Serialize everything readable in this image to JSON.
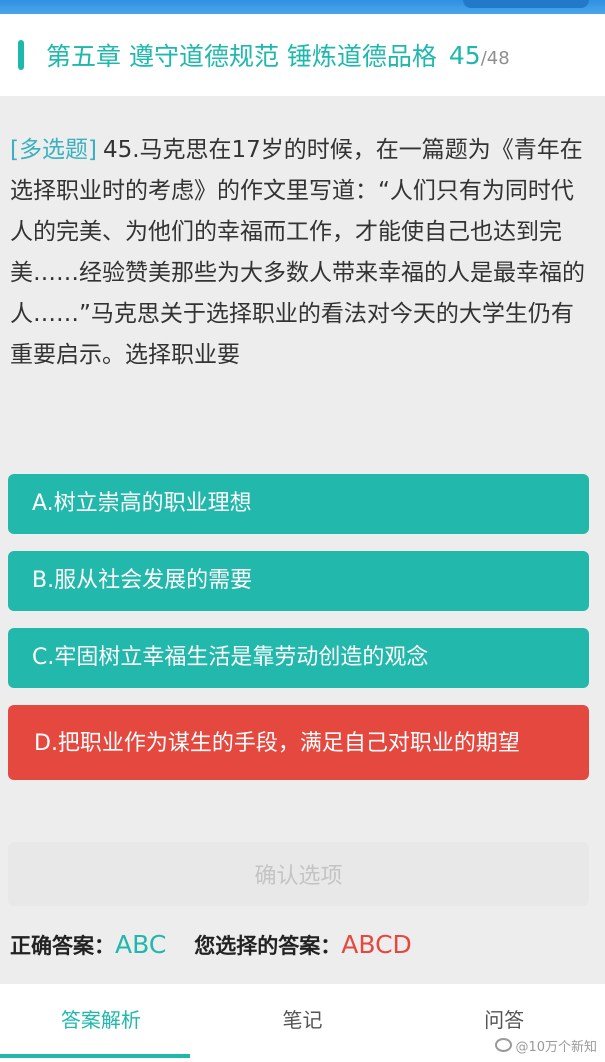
{
  "header": {
    "chapter_title": "第五章 遵守道德规范 锤炼道德品格",
    "current": "45",
    "separator": "/",
    "total": "48"
  },
  "question": {
    "type": "[多选题]",
    "text": "45.马克思在17岁的时候，在一篇题为《青年在选择职业时的考虑》的作文里写道：“人们只有为同时代人的完美、为他们的幸福而工作，才能使自己也达到完美……经验赞美那些为大多数人带来幸福的人是最幸福的人……”马克思关于选择职业的看法对今天的大学生仍有重要启示。选择职业要"
  },
  "options": [
    {
      "label": "A.树立崇高的职业理想",
      "status": "correct"
    },
    {
      "label": "B.服从社会发展的需要",
      "status": "correct"
    },
    {
      "label": "C.牢固树立幸福生活是靠劳动创造的观念",
      "status": "correct"
    },
    {
      "label": "D.把职业作为谋生的手段，满足自己对职业的期望",
      "status": "wrong"
    }
  ],
  "confirm_label": "确认选项",
  "answers": {
    "correct_label": "正确答案：",
    "correct_value": "ABC",
    "user_label": "您选择的答案：",
    "user_value": "ABCD"
  },
  "tabs": [
    {
      "label": "答案解析",
      "active": true
    },
    {
      "label": "笔记",
      "active": false
    },
    {
      "label": "问答",
      "active": false
    }
  ],
  "watermark": "@10万个新知",
  "colors": {
    "accent": "#1fb8ac",
    "wrong": "#e5483f",
    "option_bg": "#22b8ac"
  }
}
